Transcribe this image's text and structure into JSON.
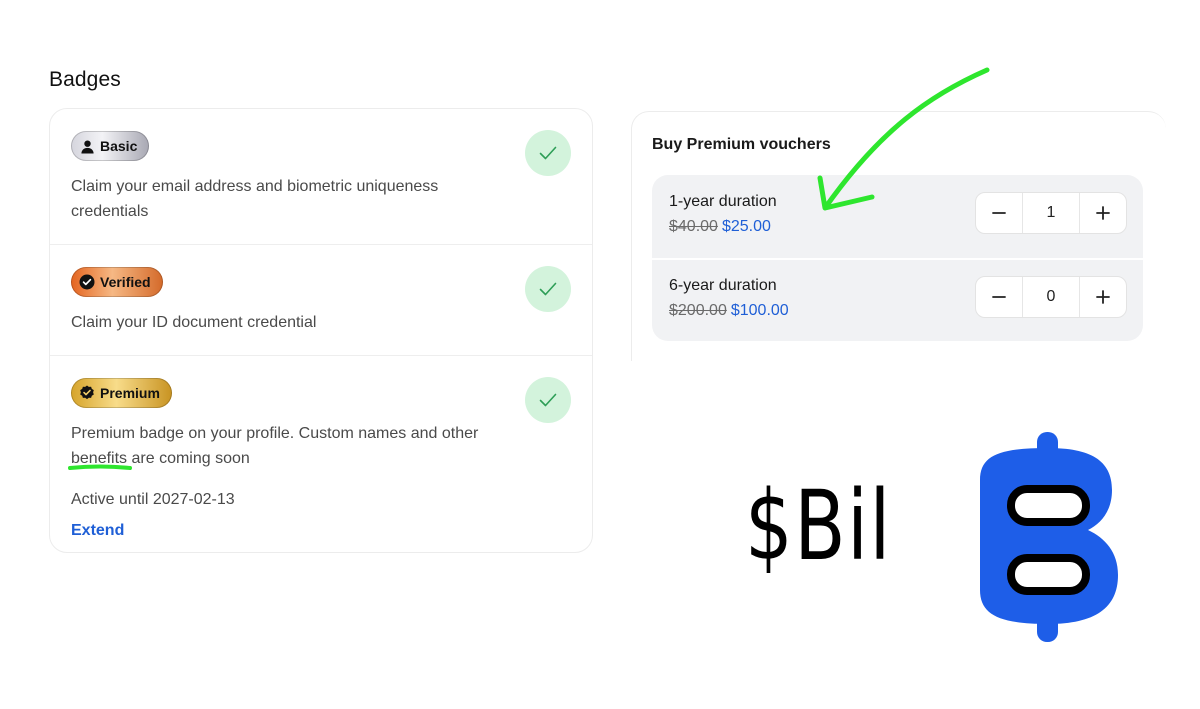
{
  "badges": {
    "title": "Badges",
    "items": [
      {
        "label": "Basic",
        "description": "Claim your email address and biometric uniqueness credentials",
        "icon": "user-icon",
        "status_icon": "check-icon"
      },
      {
        "label": "Verified",
        "description": "Claim your ID document credential",
        "icon": "check-badge-icon",
        "status_icon": "check-icon"
      },
      {
        "label": "Premium",
        "description_part1": "Premium badge on your profile. Custom names and other ",
        "description_highlight": "benefits",
        "description_part2": " are coming soon",
        "active_until": "Active until 2027-02-13",
        "extend_label": "Extend",
        "icon": "verified-seal-icon",
        "status_icon": "check-icon"
      }
    ]
  },
  "vouchers": {
    "title": "Buy Premium vouchers",
    "items": [
      {
        "name": "1-year duration",
        "old_price": "$40.00",
        "new_price": "$25.00",
        "quantity": "1"
      },
      {
        "name": "6-year duration",
        "old_price": "$200.00",
        "new_price": "$100.00",
        "quantity": "0"
      }
    ]
  },
  "overlay": {
    "ticker": "$Bil",
    "logo_icon": "blue-b-coin-icon",
    "annotation_color": "#2ee62e",
    "logo_color": "#1e5ee8"
  },
  "colors": {
    "accent_blue": "#1f5fd6",
    "check_bg": "#d3f3dc",
    "check_stroke": "#2e9e57"
  }
}
